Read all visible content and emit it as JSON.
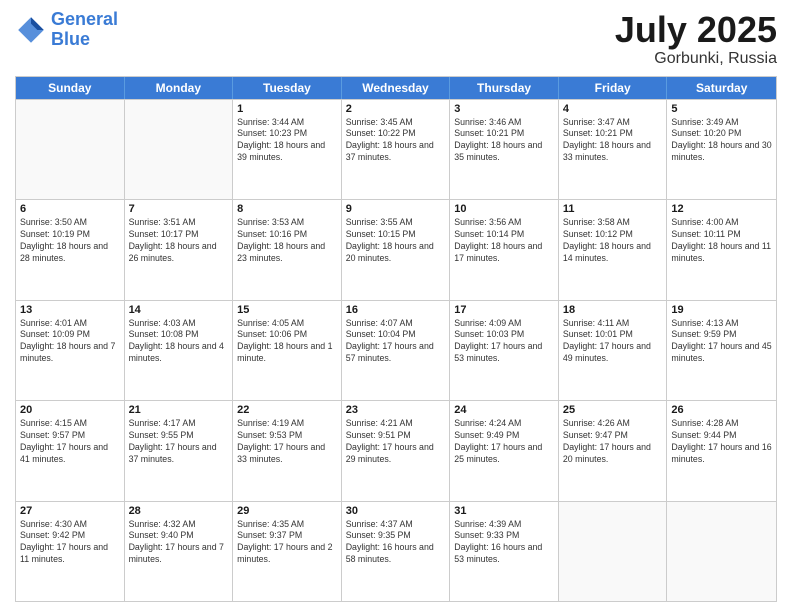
{
  "header": {
    "logo_general": "General",
    "logo_blue": "Blue",
    "month": "July 2025",
    "location": "Gorbunki, Russia"
  },
  "days_of_week": [
    "Sunday",
    "Monday",
    "Tuesday",
    "Wednesday",
    "Thursday",
    "Friday",
    "Saturday"
  ],
  "weeks": [
    [
      {
        "day": "",
        "empty": true
      },
      {
        "day": "",
        "empty": true
      },
      {
        "day": "1",
        "sunrise": "Sunrise: 3:44 AM",
        "sunset": "Sunset: 10:23 PM",
        "daylight": "Daylight: 18 hours and 39 minutes."
      },
      {
        "day": "2",
        "sunrise": "Sunrise: 3:45 AM",
        "sunset": "Sunset: 10:22 PM",
        "daylight": "Daylight: 18 hours and 37 minutes."
      },
      {
        "day": "3",
        "sunrise": "Sunrise: 3:46 AM",
        "sunset": "Sunset: 10:21 PM",
        "daylight": "Daylight: 18 hours and 35 minutes."
      },
      {
        "day": "4",
        "sunrise": "Sunrise: 3:47 AM",
        "sunset": "Sunset: 10:21 PM",
        "daylight": "Daylight: 18 hours and 33 minutes."
      },
      {
        "day": "5",
        "sunrise": "Sunrise: 3:49 AM",
        "sunset": "Sunset: 10:20 PM",
        "daylight": "Daylight: 18 hours and 30 minutes."
      }
    ],
    [
      {
        "day": "6",
        "sunrise": "Sunrise: 3:50 AM",
        "sunset": "Sunset: 10:19 PM",
        "daylight": "Daylight: 18 hours and 28 minutes."
      },
      {
        "day": "7",
        "sunrise": "Sunrise: 3:51 AM",
        "sunset": "Sunset: 10:17 PM",
        "daylight": "Daylight: 18 hours and 26 minutes."
      },
      {
        "day": "8",
        "sunrise": "Sunrise: 3:53 AM",
        "sunset": "Sunset: 10:16 PM",
        "daylight": "Daylight: 18 hours and 23 minutes."
      },
      {
        "day": "9",
        "sunrise": "Sunrise: 3:55 AM",
        "sunset": "Sunset: 10:15 PM",
        "daylight": "Daylight: 18 hours and 20 minutes."
      },
      {
        "day": "10",
        "sunrise": "Sunrise: 3:56 AM",
        "sunset": "Sunset: 10:14 PM",
        "daylight": "Daylight: 18 hours and 17 minutes."
      },
      {
        "day": "11",
        "sunrise": "Sunrise: 3:58 AM",
        "sunset": "Sunset: 10:12 PM",
        "daylight": "Daylight: 18 hours and 14 minutes."
      },
      {
        "day": "12",
        "sunrise": "Sunrise: 4:00 AM",
        "sunset": "Sunset: 10:11 PM",
        "daylight": "Daylight: 18 hours and 11 minutes."
      }
    ],
    [
      {
        "day": "13",
        "sunrise": "Sunrise: 4:01 AM",
        "sunset": "Sunset: 10:09 PM",
        "daylight": "Daylight: 18 hours and 7 minutes."
      },
      {
        "day": "14",
        "sunrise": "Sunrise: 4:03 AM",
        "sunset": "Sunset: 10:08 PM",
        "daylight": "Daylight: 18 hours and 4 minutes."
      },
      {
        "day": "15",
        "sunrise": "Sunrise: 4:05 AM",
        "sunset": "Sunset: 10:06 PM",
        "daylight": "Daylight: 18 hours and 1 minute."
      },
      {
        "day": "16",
        "sunrise": "Sunrise: 4:07 AM",
        "sunset": "Sunset: 10:04 PM",
        "daylight": "Daylight: 17 hours and 57 minutes."
      },
      {
        "day": "17",
        "sunrise": "Sunrise: 4:09 AM",
        "sunset": "Sunset: 10:03 PM",
        "daylight": "Daylight: 17 hours and 53 minutes."
      },
      {
        "day": "18",
        "sunrise": "Sunrise: 4:11 AM",
        "sunset": "Sunset: 10:01 PM",
        "daylight": "Daylight: 17 hours and 49 minutes."
      },
      {
        "day": "19",
        "sunrise": "Sunrise: 4:13 AM",
        "sunset": "Sunset: 9:59 PM",
        "daylight": "Daylight: 17 hours and 45 minutes."
      }
    ],
    [
      {
        "day": "20",
        "sunrise": "Sunrise: 4:15 AM",
        "sunset": "Sunset: 9:57 PM",
        "daylight": "Daylight: 17 hours and 41 minutes."
      },
      {
        "day": "21",
        "sunrise": "Sunrise: 4:17 AM",
        "sunset": "Sunset: 9:55 PM",
        "daylight": "Daylight: 17 hours and 37 minutes."
      },
      {
        "day": "22",
        "sunrise": "Sunrise: 4:19 AM",
        "sunset": "Sunset: 9:53 PM",
        "daylight": "Daylight: 17 hours and 33 minutes."
      },
      {
        "day": "23",
        "sunrise": "Sunrise: 4:21 AM",
        "sunset": "Sunset: 9:51 PM",
        "daylight": "Daylight: 17 hours and 29 minutes."
      },
      {
        "day": "24",
        "sunrise": "Sunrise: 4:24 AM",
        "sunset": "Sunset: 9:49 PM",
        "daylight": "Daylight: 17 hours and 25 minutes."
      },
      {
        "day": "25",
        "sunrise": "Sunrise: 4:26 AM",
        "sunset": "Sunset: 9:47 PM",
        "daylight": "Daylight: 17 hours and 20 minutes."
      },
      {
        "day": "26",
        "sunrise": "Sunrise: 4:28 AM",
        "sunset": "Sunset: 9:44 PM",
        "daylight": "Daylight: 17 hours and 16 minutes."
      }
    ],
    [
      {
        "day": "27",
        "sunrise": "Sunrise: 4:30 AM",
        "sunset": "Sunset: 9:42 PM",
        "daylight": "Daylight: 17 hours and 11 minutes."
      },
      {
        "day": "28",
        "sunrise": "Sunrise: 4:32 AM",
        "sunset": "Sunset: 9:40 PM",
        "daylight": "Daylight: 17 hours and 7 minutes."
      },
      {
        "day": "29",
        "sunrise": "Sunrise: 4:35 AM",
        "sunset": "Sunset: 9:37 PM",
        "daylight": "Daylight: 17 hours and 2 minutes."
      },
      {
        "day": "30",
        "sunrise": "Sunrise: 4:37 AM",
        "sunset": "Sunset: 9:35 PM",
        "daylight": "Daylight: 16 hours and 58 minutes."
      },
      {
        "day": "31",
        "sunrise": "Sunrise: 4:39 AM",
        "sunset": "Sunset: 9:33 PM",
        "daylight": "Daylight: 16 hours and 53 minutes."
      },
      {
        "day": "",
        "empty": true
      },
      {
        "day": "",
        "empty": true
      }
    ]
  ]
}
